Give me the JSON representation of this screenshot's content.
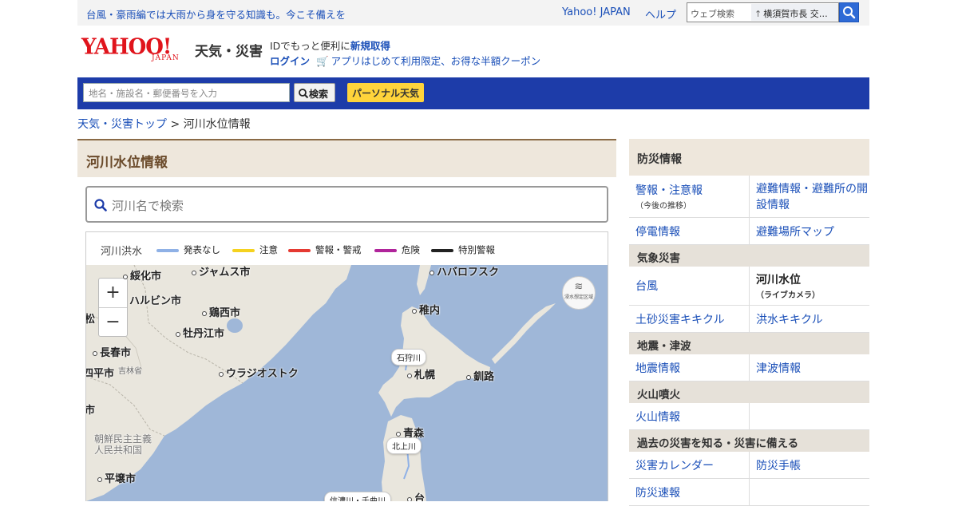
{
  "topbar": {
    "promo": "台風・豪雨編では大雨から身を守る知識も。今こそ備えを",
    "yahoo_japan": "Yahoo! JAPAN",
    "help": "ヘルプ",
    "web_search_placeholder": "ウェブ検索",
    "web_search_suggestion": "横須賀市長 交…"
  },
  "header": {
    "logo": "YAHOO!",
    "logo_sub": "JAPAN",
    "service_name": "天気・災害",
    "id_text": "IDでもっと便利に",
    "id_link": "新規取得",
    "login": "ログイン",
    "coupon": "アプリはじめて利用限定、お得な半額クーポン"
  },
  "search_band": {
    "place_placeholder": "地名・施設名・郵便番号を入力",
    "search_button": "検索",
    "personal_button": "パーソナル天気"
  },
  "breadcrumb": {
    "home": "天気・災害トップ",
    "separator": ">",
    "current": "河川水位情報"
  },
  "main": {
    "title": "河川水位情報",
    "river_search_placeholder": "河川名で検索",
    "legend": {
      "title": "河川洪水",
      "items": [
        {
          "label": "発表なし",
          "color": "#8fb1e6"
        },
        {
          "label": "注意",
          "color": "#f5d21f"
        },
        {
          "label": "警報・警戒",
          "color": "#e53a32"
        },
        {
          "label": "危険",
          "color": "#b0249b"
        },
        {
          "label": "特別警報",
          "color": "#222222"
        }
      ]
    },
    "map": {
      "zoom_in": "+",
      "zoom_out": "−",
      "flood_button_icon": "waves-icon",
      "flood_button_text": "浸水想定区域",
      "cities": [
        "綏化市",
        "ジャムス市",
        "ハルビン市",
        "鶏西市",
        "牡丹江市",
        "長春市",
        "吉林省",
        "ウラジオストク",
        "平壌市",
        "ハバロフスク",
        "稚内",
        "札幌",
        "釧路",
        "青森",
        "台",
        "朝鮮民主主義人民共和国",
        "四平市",
        "松",
        "市"
      ],
      "rivers": [
        "石狩川",
        "北上川",
        "信濃川・千曲川"
      ]
    }
  },
  "sidebar": {
    "header": "防災情報",
    "rows1": [
      [
        {
          "label": "警報・注意報",
          "sub": "（今後の推移）"
        },
        {
          "label": "避難情報・避難所の開設情報",
          "sub": ""
        }
      ],
      [
        {
          "label": "停電情報",
          "sub": ""
        },
        {
          "label": "避難場所マップ",
          "sub": ""
        }
      ]
    ],
    "sec_weather": "気象災害",
    "rows2": [
      [
        {
          "label": "台風",
          "sub": ""
        },
        {
          "label": "河川水位",
          "sub": "（ライブカメラ）"
        }
      ],
      [
        {
          "label": "土砂災害キキクル",
          "sub": ""
        },
        {
          "label": "洪水キキクル",
          "sub": ""
        }
      ]
    ],
    "sec_quake": "地震・津波",
    "rows3": [
      [
        {
          "label": "地震情報",
          "sub": ""
        },
        {
          "label": "津波情報",
          "sub": ""
        }
      ]
    ],
    "sec_volcano": "火山噴火",
    "rows4": [
      [
        {
          "label": "火山情報",
          "sub": ""
        },
        {
          "label": "",
          "sub": ""
        }
      ]
    ],
    "sec_past": "過去の災害を知る・災害に備える",
    "rows5": [
      [
        {
          "label": "災害カレンダー",
          "sub": ""
        },
        {
          "label": "防災手帳",
          "sub": ""
        }
      ],
      [
        {
          "label": "防災速報",
          "sub": ""
        },
        {
          "label": "",
          "sub": ""
        }
      ]
    ]
  }
}
